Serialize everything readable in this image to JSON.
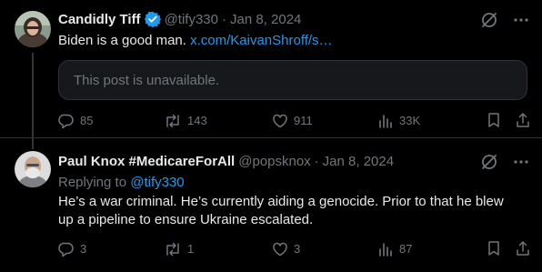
{
  "tweets": [
    {
      "name": "Candidly Tiff",
      "handle": "@tify330",
      "separator": "·",
      "date": "Jan 8, 2024",
      "text": "Biden is a good man.",
      "link_text": "x.com/KaivanShroff/s…",
      "quoted_post": "This post is unavailable.",
      "stats": {
        "replies": "85",
        "reposts": "143",
        "likes": "911",
        "views": "33K"
      }
    },
    {
      "name": "Paul Knox #MedicareForAll",
      "handle": "@popsknox",
      "separator": "·",
      "date": "Jan 8, 2024",
      "replying_prefix": "Replying to",
      "replying_handle": "@tify330",
      "text_line1": "He’s a war criminal. He’s currently aiding a genocide. Prior to that he blew",
      "text_line2": "up a pipeline to ensure Ukraine escalated.",
      "stats": {
        "replies": "3",
        "reposts": "1",
        "likes": "3",
        "views": "87"
      }
    }
  ],
  "colors": {
    "background": "#000000",
    "text": "#e7e9ea",
    "muted": "#71767b",
    "link": "#1d9bf0",
    "border": "#2f3336"
  },
  "icons": [
    "verified-badge-icon",
    "grok-icon",
    "more-icon",
    "reply-icon",
    "repost-icon",
    "like-icon",
    "views-icon",
    "bookmark-icon",
    "share-icon"
  ]
}
